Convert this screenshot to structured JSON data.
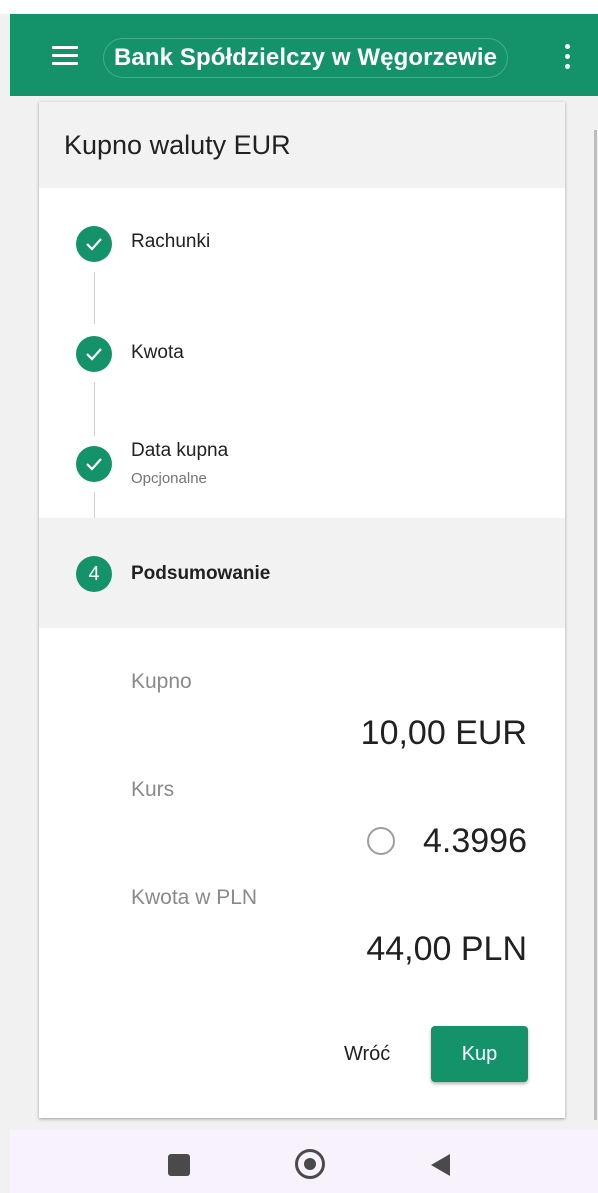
{
  "app_bar": {
    "title": "Bank Spółdzielczy w Węgorzewie",
    "menu_icon": "menu-icon",
    "more_icon": "more-vertical-icon",
    "color": "#14936a"
  },
  "card": {
    "title": "Kupno waluty EUR",
    "steps": [
      {
        "label": "Rachunki",
        "state": "completed",
        "icon": "check-icon"
      },
      {
        "label": "Kwota",
        "state": "completed",
        "icon": "check-icon"
      },
      {
        "label": "Data kupna",
        "sublabel": "Opcjonalne",
        "state": "completed",
        "icon": "check-icon"
      },
      {
        "number": "4",
        "label": "Podsumowanie",
        "state": "active"
      }
    ],
    "summary": {
      "kupno_label": "Kupno",
      "kupno_value": "10,00 EUR",
      "kurs_label": "Kurs",
      "kurs_value": "4.3996",
      "kurs_icon": "circle-timer-icon",
      "kwota_label": "Kwota w PLN",
      "kwota_value": "44,00 PLN"
    },
    "buttons": {
      "back": "Wróć",
      "buy": "Kup"
    }
  },
  "system_nav": {
    "recents_icon": "square-icon",
    "home_icon": "circle-home-icon",
    "back_icon": "triangle-back-icon"
  }
}
